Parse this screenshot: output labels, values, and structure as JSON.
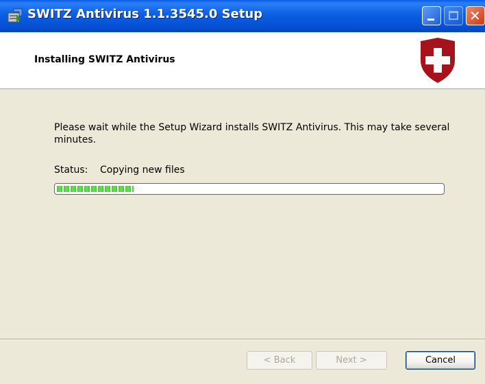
{
  "window": {
    "title": "SWITZ Antivirus 1.1.3545.0 Setup",
    "icon": "installer-icon",
    "controls": [
      "minimize-icon",
      "maximize-icon",
      "close-icon"
    ]
  },
  "header": {
    "title": "Installing SWITZ Antivirus",
    "logo": "shield-cross-icon",
    "logo_color": "#a6131a"
  },
  "body": {
    "description": "Please wait while the Setup Wizard installs SWITZ Antivirus. This may take several minutes.",
    "status_label": "Status:",
    "status_value": "Copying new files",
    "progress_fraction": 0.2
  },
  "buttons": {
    "back": "< Back",
    "next": "Next >",
    "cancel": "Cancel"
  },
  "colors": {
    "titlebar": "#0551d7",
    "progress": "#3fcf2a",
    "dialog_bg": "#ece9d8"
  }
}
